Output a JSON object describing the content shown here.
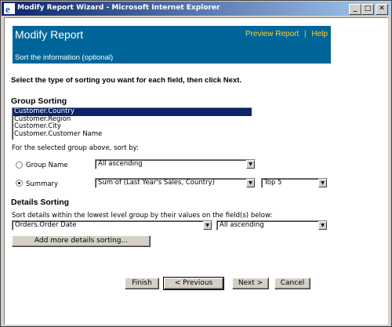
{
  "window": {
    "title": "Modify Report Wizard - Microsoft Internet Explorer",
    "min": "_",
    "max": "□",
    "close": "✕"
  },
  "banner": {
    "title": "Modify Report",
    "preview_link": "Preview Report",
    "separator": "|",
    "help_link": "Help",
    "subtitle": "Sort the information (optional)"
  },
  "instruction": "Select the type of sorting you want for each field, then click Next.",
  "group_sorting": {
    "heading": "Group Sorting",
    "groups": [
      "Customer.Country",
      "Customer.Region",
      "Customer.City",
      "Customer.Customer Name"
    ],
    "selected_index": 0,
    "sort_by_label": "For the selected group above, sort by:",
    "group_name_label": "Group Name",
    "group_name_value": "All ascending",
    "summary_label": "Summary",
    "summary_value": "Sum of (Last Year's Sales, Country)",
    "top_value": "Top 5",
    "selected_option": "summary"
  },
  "details_sorting": {
    "heading": "Details Sorting",
    "description": "Sort details within the lowest level group by their values on the field(s) below:",
    "field_value": "Orders.Order Date",
    "order_value": "All ascending",
    "add_button": "Add more details sorting..."
  },
  "buttons": {
    "finish": "Finish",
    "previous": "< Previous",
    "next": "Next >",
    "cancel": "Cancel"
  },
  "icons": {
    "dropdown": "▼",
    "ie": "ie-logo-icon"
  }
}
